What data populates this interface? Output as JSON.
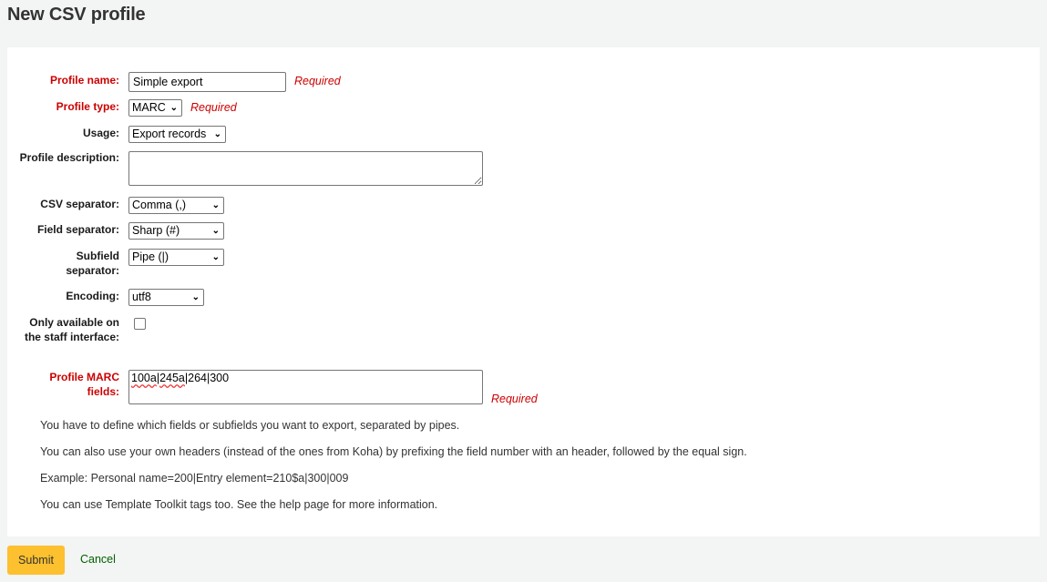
{
  "page": {
    "title": "New CSV profile"
  },
  "form": {
    "required_text": "Required",
    "profile_name": {
      "label": "Profile name:",
      "value": "Simple export"
    },
    "profile_type": {
      "label": "Profile type:",
      "value": "MARC"
    },
    "usage": {
      "label": "Usage:",
      "value": "Export records"
    },
    "profile_description": {
      "label": "Profile description:",
      "value": ""
    },
    "csv_separator": {
      "label": "CSV separator:",
      "value": "Comma (,)"
    },
    "field_separator": {
      "label": "Field separator:",
      "value": "Sharp (#)"
    },
    "subfield_separator": {
      "label": "Subfield separator:",
      "value": "Pipe (|)"
    },
    "encoding": {
      "label": "Encoding:",
      "value": "utf8"
    },
    "staff_only": {
      "label": "Only available on the staff interface:",
      "checked": false
    },
    "marc_fields": {
      "label": "Profile MARC fields:",
      "value_part1": "100a",
      "value_sep": "|",
      "value_part2": "245a",
      "value_rest": "|264|300"
    },
    "hints": [
      "You have to define which fields or subfields you want to export, separated by pipes.",
      "You can also use your own headers (instead of the ones from Koha) by prefixing the field number with an header, followed by the equal sign.",
      "Example: Personal name=200|Entry element=210$a|300|009",
      "You can use Template Toolkit tags too. See the help page for more information."
    ]
  },
  "actions": {
    "submit": "Submit",
    "cancel": "Cancel"
  },
  "colors": {
    "required": "#cc0000",
    "submit_bg": "#fdc02f",
    "cancel_link": "#006100"
  }
}
